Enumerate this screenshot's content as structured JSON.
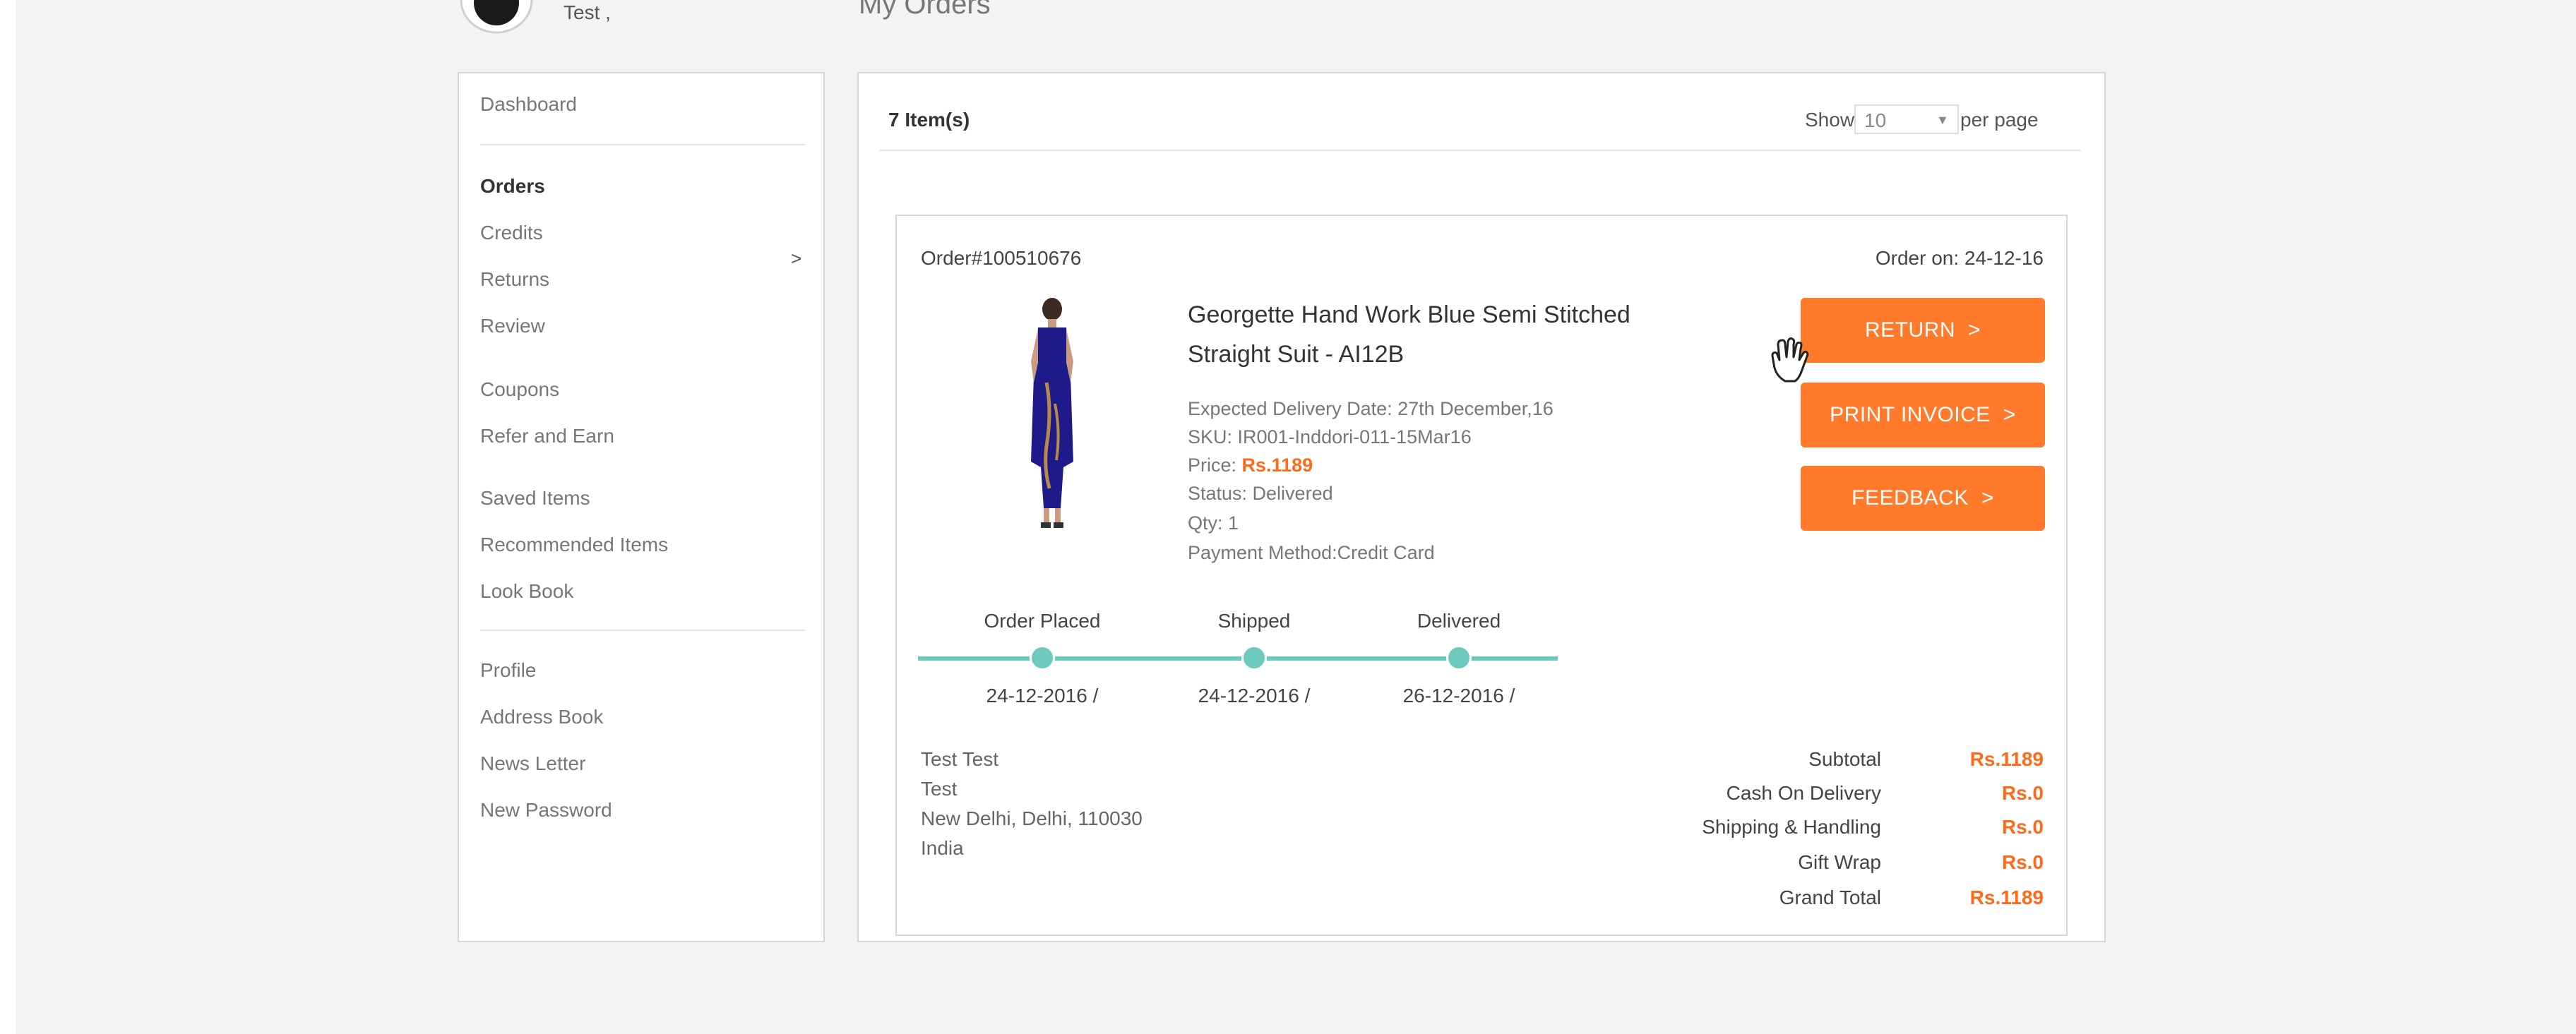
{
  "header": {
    "user_name": "Test ,",
    "page_title": "My Orders"
  },
  "sidebar": {
    "items": [
      {
        "label": "Dashboard"
      },
      {
        "label": "Orders",
        "active": true,
        "caret": ">"
      },
      {
        "label": "Credits"
      },
      {
        "label": "Returns"
      },
      {
        "label": "Review"
      },
      {
        "label": "Coupons"
      },
      {
        "label": "Refer and Earn"
      },
      {
        "label": "Saved Items"
      },
      {
        "label": "Recommended Items"
      },
      {
        "label": "Look Book"
      },
      {
        "label": "Profile"
      },
      {
        "label": "Address Book"
      },
      {
        "label": "News Letter"
      },
      {
        "label": "New Password"
      }
    ]
  },
  "orders_header": {
    "items_count": "7 Item(s)",
    "show_label": "Show",
    "per_page_value": "10",
    "per_page_suffix": "per page"
  },
  "order": {
    "number": "Order#100510676",
    "date": "Order on: 24-12-16",
    "product_title": "Georgette Hand Work Blue Semi Stitched Straight Suit - AI12B",
    "expected_delivery": "Expected Delivery Date: 27th December,16",
    "sku": "SKU: IR001-Inddori-011-15Mar16",
    "price_label": "Price: ",
    "price_value": "Rs.1189",
    "status": "Status: Delivered",
    "qty": "Qty: 1",
    "payment_method": "Payment Method:Credit Card",
    "buttons": {
      "return": "RETURN",
      "print_invoice": "PRINT INVOICE",
      "feedback": "FEEDBACK",
      "chevron": ">"
    },
    "progress": [
      {
        "label": "Order Placed",
        "date": "24-12-2016 /"
      },
      {
        "label": "Shipped",
        "date": "24-12-2016 /"
      },
      {
        "label": "Delivered",
        "date": "26-12-2016 /"
      }
    ],
    "address": [
      "Test Test",
      "Test",
      "New Delhi, Delhi, 110030",
      "India"
    ],
    "summary": [
      {
        "label": "Subtotal",
        "value": "Rs.1189"
      },
      {
        "label": "Cash On Delivery",
        "value": "Rs.0"
      },
      {
        "label": "Shipping & Handling",
        "value": "Rs.0"
      },
      {
        "label": "Gift Wrap",
        "value": "Rs.0"
      },
      {
        "label": "Grand Total",
        "value": "Rs.1189"
      }
    ]
  },
  "colors": {
    "accent": "#ff7a2b",
    "progress": "#6cc9bc",
    "price": "#ff6a1a",
    "product_dress": "#1f1a8a"
  }
}
